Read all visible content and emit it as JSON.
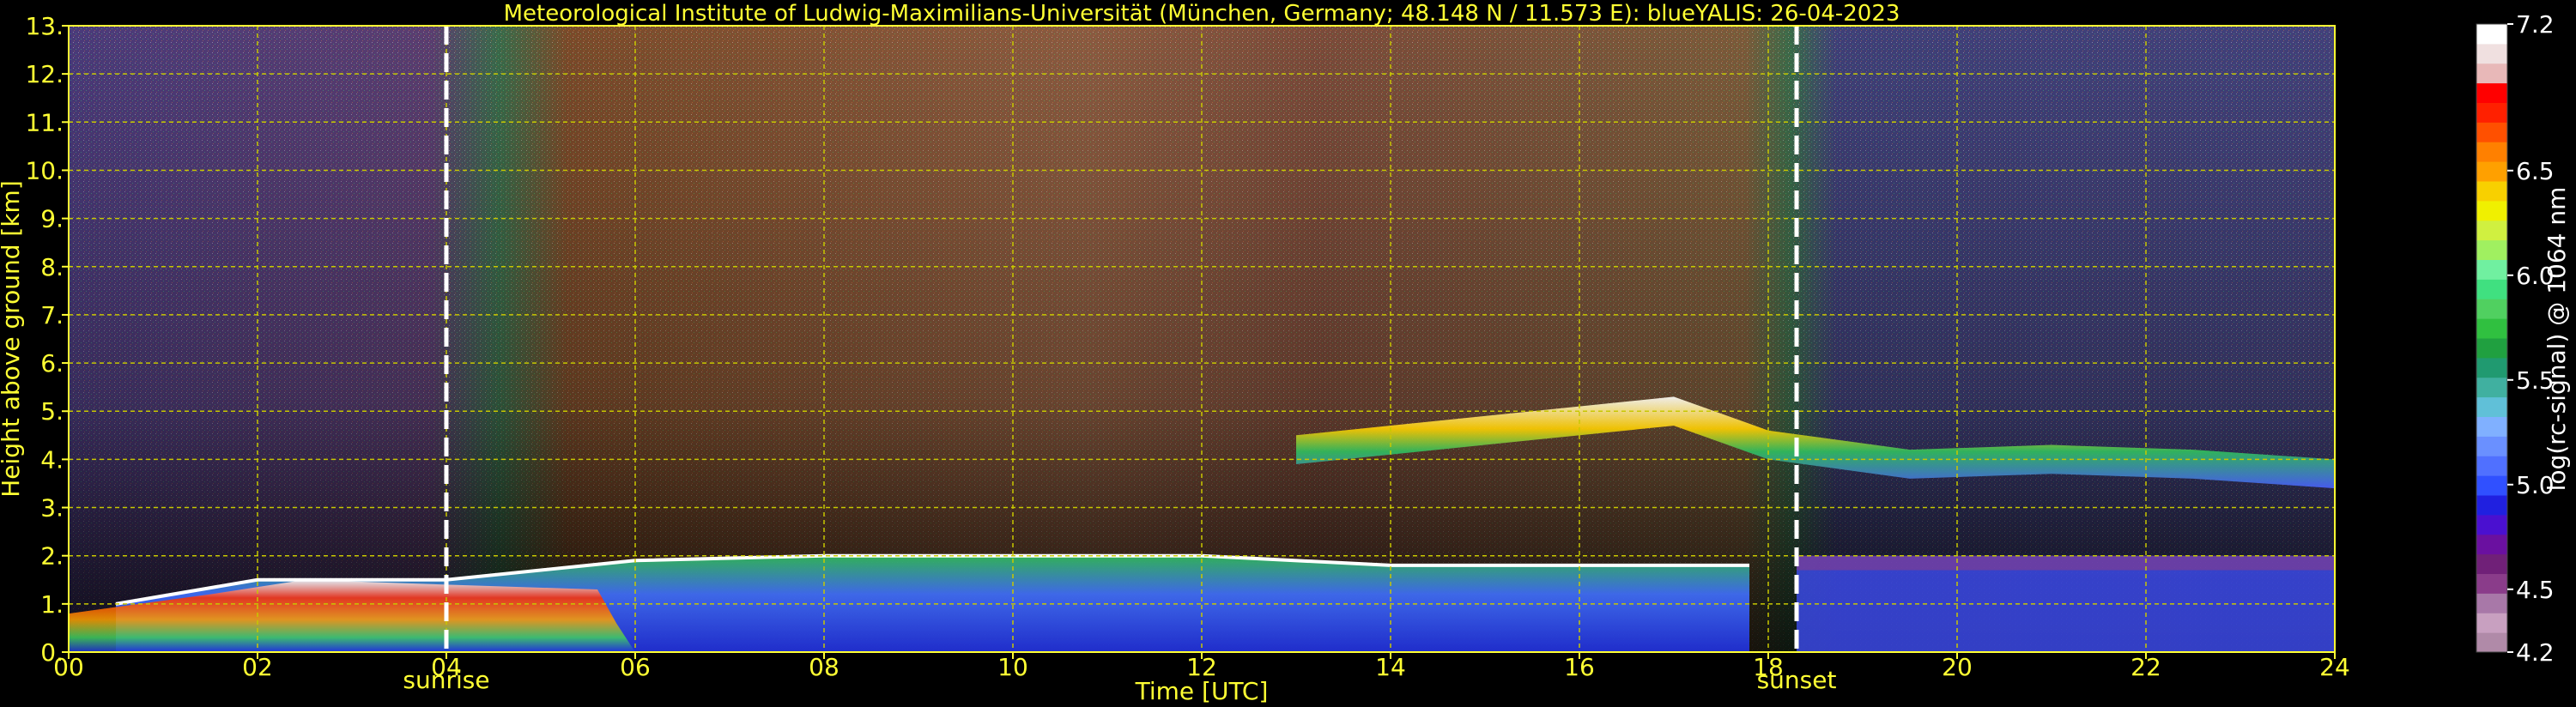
{
  "chart_data": {
    "type": "heatmap",
    "title": "Meteorological Institute of Ludwig-Maximilians-Universität (München, Germany; 48.148 N / 11.573 E):    blueYALIS: 26-04-2023",
    "xlabel": "Time [UTC]",
    "ylabel": "Height above ground [km]",
    "xlim": [
      0,
      24
    ],
    "ylim": [
      0,
      13
    ],
    "x_ticks": [
      "00",
      "02",
      "04",
      "06",
      "08",
      "10",
      "12",
      "14",
      "16",
      "18",
      "20",
      "22",
      "24"
    ],
    "y_ticks": [
      "0.",
      "1.",
      "2.",
      "3.",
      "4.",
      "5.",
      "6.",
      "7.",
      "8.",
      "9.",
      "10.",
      "11.",
      "12.",
      "13."
    ],
    "grid": true,
    "annotations": [
      {
        "label": "sunrise",
        "x": 4.0
      },
      {
        "label": "sunset",
        "x": 18.3
      }
    ],
    "colorbar": {
      "label": "log(rc-signal) @ 1064 nm",
      "range": [
        4.2,
        7.2
      ],
      "ticks": [
        "4.2",
        "4.5",
        "5.0",
        "5.5",
        "6.0",
        "6.5",
        "7.2"
      ]
    },
    "features": {
      "boundary_layer_top_km": [
        {
          "x": 0.5,
          "y": 1.0
        },
        {
          "x": 2,
          "y": 1.5
        },
        {
          "x": 4,
          "y": 1.5
        },
        {
          "x": 6,
          "y": 1.9
        },
        {
          "x": 8,
          "y": 2.0
        },
        {
          "x": 10,
          "y": 2.0
        },
        {
          "x": 12,
          "y": 2.0
        },
        {
          "x": 14,
          "y": 1.8
        },
        {
          "x": 16,
          "y": 1.8
        },
        {
          "x": 17.8,
          "y": 1.8
        }
      ],
      "cloud_layer_km": [
        {
          "x": 13.0,
          "y": 4.5
        },
        {
          "x": 15.5,
          "y": 5.0
        },
        {
          "x": 17.0,
          "y": 5.3
        },
        {
          "x": 18.0,
          "y": 4.6
        },
        {
          "x": 19.5,
          "y": 4.2
        },
        {
          "x": 21.0,
          "y": 4.3
        },
        {
          "x": 22.5,
          "y": 4.2
        },
        {
          "x": 24.0,
          "y": 4.0
        }
      ]
    }
  },
  "colors": {
    "text": "#ffff33",
    "grid": "#c8c800",
    "background": "#000000",
    "colorbar": [
      "#b08aa8",
      "#c8a0c0",
      "#a878a8",
      "#8a3c8a",
      "#702078",
      "#6a10a0",
      "#4a10d0",
      "#2020e0",
      "#3050ff",
      "#5070ff",
      "#6a90ff",
      "#80b0ff",
      "#60c0d8",
      "#40b0a0",
      "#209a70",
      "#20a040",
      "#30c040",
      "#50d060",
      "#40e080",
      "#70f0a0",
      "#a0f060",
      "#d0f040",
      "#f0f000",
      "#f8d000",
      "#ffa000",
      "#ff8000",
      "#ff5000",
      "#ff2000",
      "#ff0000",
      "#e8b8b8",
      "#f0e0e0",
      "#ffffff"
    ]
  }
}
